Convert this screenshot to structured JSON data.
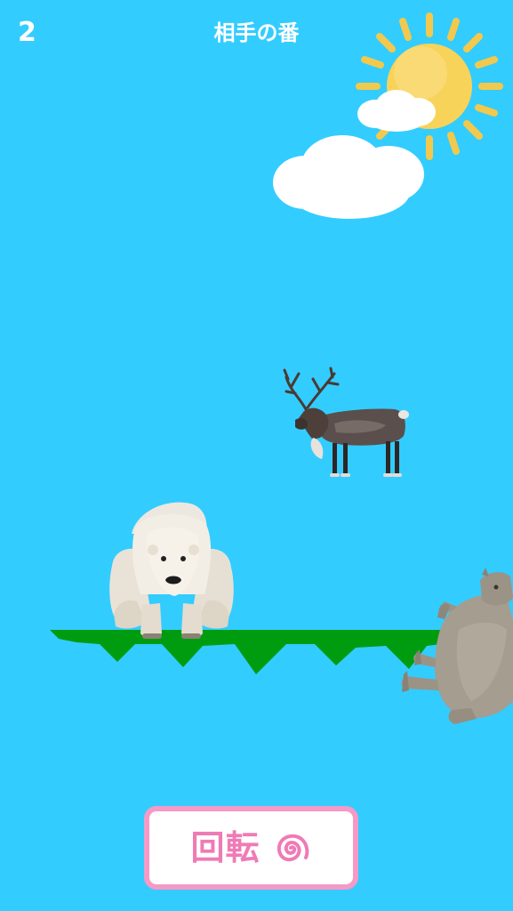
{
  "hud": {
    "score": "2",
    "turn_text": "相手の番"
  },
  "controls": {
    "rotate_label": "回転",
    "rotate_icon": "spiral-icon"
  },
  "scene": {
    "background_color": "#33ccff",
    "platform_color": "#009c10",
    "button_border_color": "#f59ac6",
    "button_text_color": "#ef7bb6",
    "sun_color": "#f7d35a",
    "animals": [
      "polar-bear",
      "reindeer",
      "rhinoceros"
    ]
  }
}
